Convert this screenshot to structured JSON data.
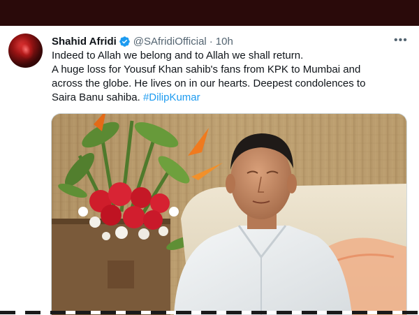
{
  "tweet": {
    "author_name": "Shahid Afridi",
    "handle": "@SAfridiOfficial",
    "separator": "·",
    "time": "10h",
    "more_label": "•••",
    "text_lines": [
      "Indeed to Allah we belong and to Allah we shall return.",
      "A huge loss for Yousuf Khan sahib's fans from KPK to Mumbai and",
      "across the globe. He lives on in our hearts. Deepest condolences to"
    ],
    "last_line_text": "Saira Banu sahiba.",
    "hashtag": "#DilipKumar"
  },
  "icons": {
    "verified": "verified-badge-icon",
    "more": "more-options-icon"
  },
  "colors": {
    "link": "#1d9bf0",
    "verified": "#1d9bf0",
    "text": "#0f1419",
    "muted": "#536471",
    "top_bar": "#2a0a0a"
  }
}
